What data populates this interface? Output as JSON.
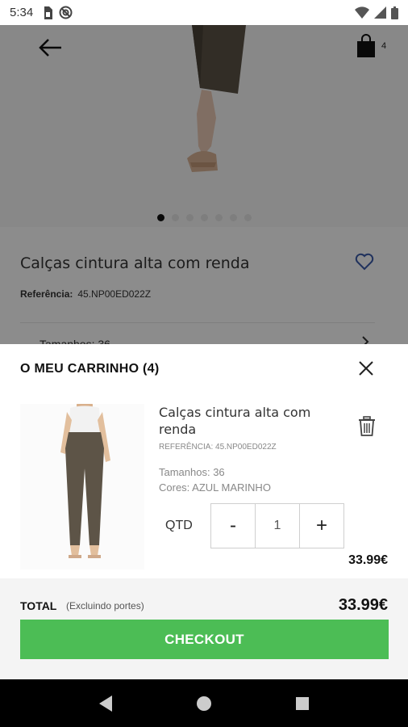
{
  "status_bar": {
    "time": "5:34"
  },
  "product": {
    "bag_count": "4",
    "title": "Calças cintura alta com renda",
    "reference_label": "Referência:",
    "reference_value": "45.NP00ED022Z",
    "size_text": "Tamanhos: 36",
    "carousel_dots": 7,
    "carousel_active": 0
  },
  "cart": {
    "title": "O MEU CARRINHO (4)",
    "item": {
      "name": "Calças cintura alta com renda",
      "reference": "REFERÊNCIA: 45.NP00ED022Z",
      "size": "Tamanhos: 36",
      "color": "Cores: AZUL MARINHO",
      "qty_label": "QTD",
      "qty_minus": "-",
      "qty_value": "1",
      "qty_plus": "+",
      "price": "33.99€"
    },
    "total_label": "TOTAL",
    "total_note": "(Excluindo portes)",
    "total_value": "33.99€",
    "checkout_label": "CHECKOUT"
  },
  "colors": {
    "checkout_green": "#4cbd55",
    "heart_blue": "#3b5ba9",
    "nav_black": "#000000"
  },
  "icons": [
    "back-arrow-icon",
    "shopping-bag-icon",
    "heart-icon",
    "chevron-right-icon",
    "close-icon",
    "trash-icon",
    "nav-back-icon",
    "nav-home-icon",
    "nav-recents-icon",
    "wifi-icon",
    "signal-icon",
    "battery-icon",
    "sim-icon",
    "at-sign-icon"
  ]
}
